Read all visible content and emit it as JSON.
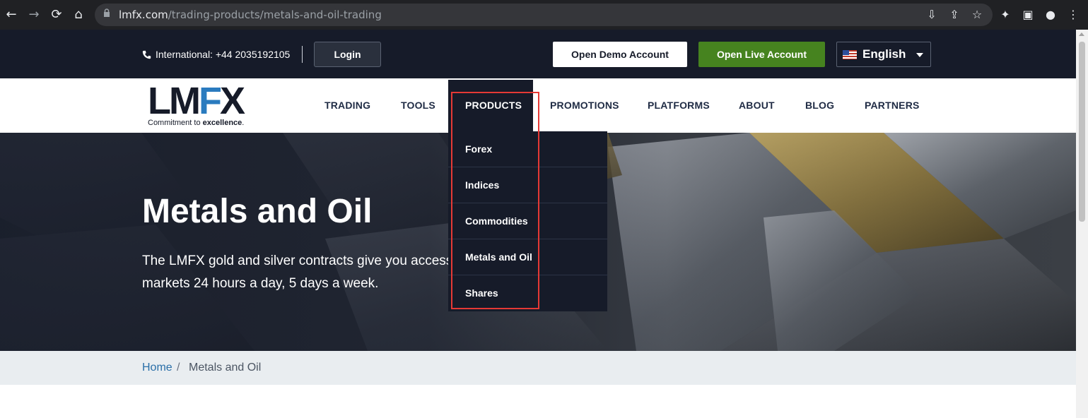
{
  "browser": {
    "url_host": "lmfx.com",
    "url_path": "/trading-products/metals-and-oil-trading",
    "icons": [
      "back-icon",
      "forward-icon",
      "reload-icon",
      "home-icon",
      "lock-icon",
      "install-icon",
      "share-icon",
      "star-icon",
      "extensions-icon",
      "sidepanel-icon",
      "profile-icon",
      "menu-icon"
    ]
  },
  "topbar": {
    "phone": "International: +44 2035192105",
    "login": "Login",
    "demo": "Open Demo Account",
    "live": "Open Live Account",
    "language": "English"
  },
  "logo": {
    "text_l": "LM",
    "text_f": "F",
    "text_x": "X",
    "tagline_prefix": "Commitment to ",
    "tagline_emph": "excellence",
    "tagline_suffix": "."
  },
  "nav": {
    "items": [
      "TRADING",
      "TOOLS",
      "PRODUCTS",
      "PROMOTIONS",
      "PLATFORMS",
      "ABOUT",
      "BLOG",
      "PARTNERS"
    ]
  },
  "products_menu": {
    "items": [
      "Forex",
      "Indices",
      "Commodities",
      "Metals and Oil",
      "Shares"
    ]
  },
  "hero": {
    "title": "Metals and Oil",
    "lead_line1": "The LMFX gold and silver contracts give you access t",
    "lead_line2": "markets 24 hours a day, 5 days a week."
  },
  "breadcrumb": {
    "home": "Home",
    "separator": "/",
    "current": "Metals and Oil"
  },
  "colors": {
    "navy": "#161b29",
    "green": "#46831f",
    "accent_blue": "#2a7bbf",
    "highlight_red": "#e53935"
  }
}
